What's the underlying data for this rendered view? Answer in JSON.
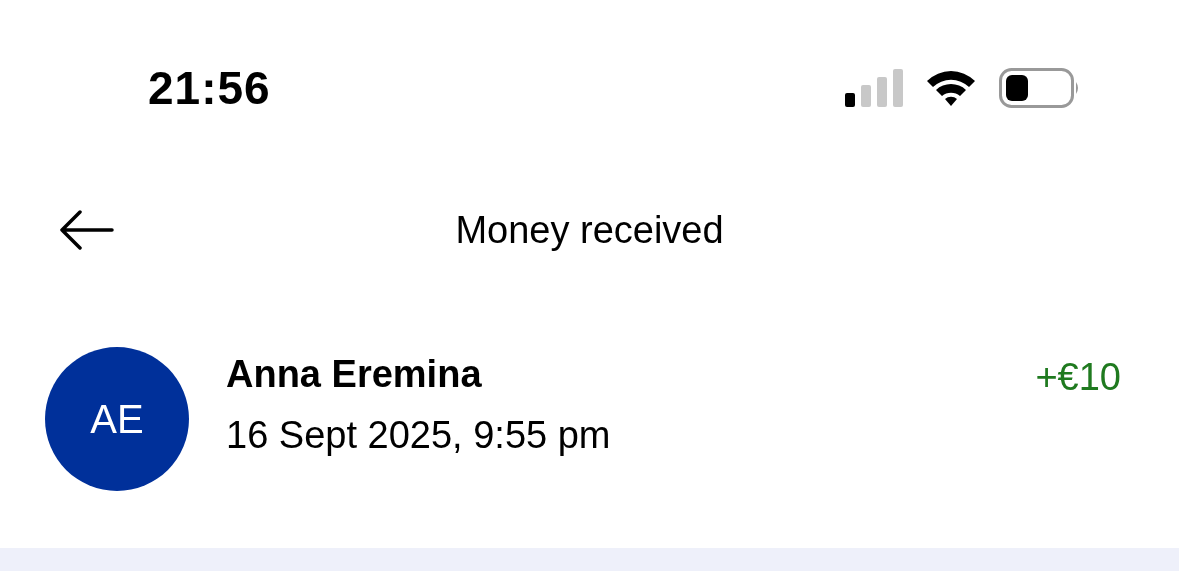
{
  "status_bar": {
    "time": "21:56"
  },
  "header": {
    "title": "Money received"
  },
  "transaction": {
    "initials": "AE",
    "name": "Anna Eremina",
    "date": "16 Sept 2025, 9:55 pm",
    "amount": "+€10"
  }
}
